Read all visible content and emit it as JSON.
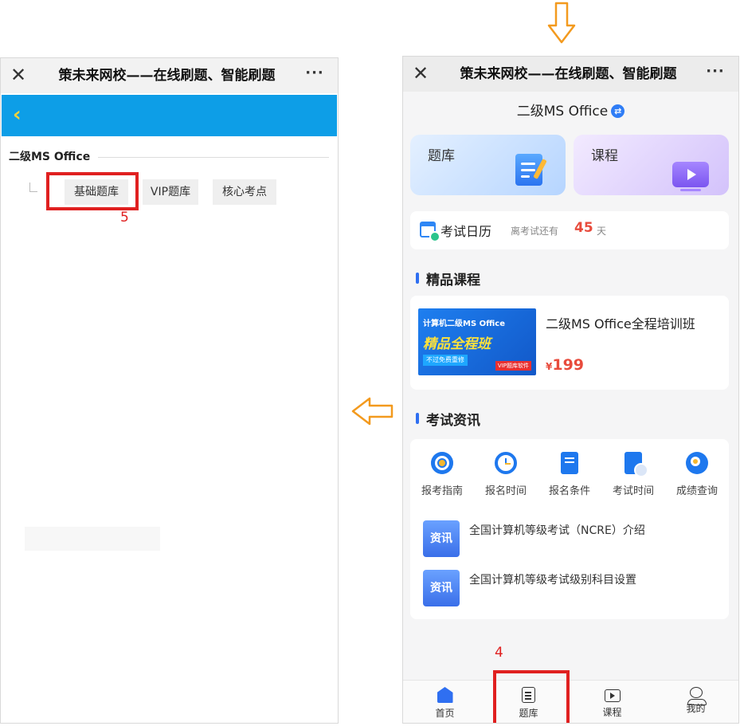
{
  "app_title": "策未来网校——在线刷题、智能刷题",
  "top_bar": {
    "close_glyph": "✕",
    "more_glyph": "···",
    "back_glyph": "‹"
  },
  "left_screen": {
    "section_title": "二级MS Office",
    "chips": [
      "基础题库",
      "VIP题库",
      "核心考点"
    ],
    "step_label": "5"
  },
  "right_screen": {
    "page_title": "二级MS Office",
    "cards": {
      "tiku_label": "题库",
      "course_label": "课程"
    },
    "exam_calendar": {
      "title": "考试日历",
      "countdown_prefix": "离考试还有",
      "countdown_days": "45",
      "countdown_unit": "天"
    },
    "featured_section_title": "精品课程",
    "course": {
      "name": "二级MS Office全程培训班",
      "price_symbol": "¥",
      "price": "199",
      "thumb_line1": "计算机二级MS Office",
      "thumb_line2": "精品全程班",
      "thumb_line3": "不过免费重修",
      "thumb_tag": "VIP题库软件"
    },
    "news_section_title": "考试资讯",
    "quick_links": [
      "报考指南",
      "报名时间",
      "报名条件",
      "考试时间",
      "成绩查询"
    ],
    "news_items": [
      {
        "tag": "资讯",
        "title": "全国计算机等级考试（NCRE）介绍"
      },
      {
        "tag": "资讯",
        "title": "全国计算机等级考试级别科目设置"
      }
    ],
    "step_label": "4",
    "tabs": [
      {
        "label": "首页",
        "icon": "home-icon"
      },
      {
        "label": "题库",
        "icon": "question-bank-icon"
      },
      {
        "label": "课程",
        "icon": "course-icon"
      },
      {
        "label": "我的",
        "icon": "profile-icon"
      }
    ]
  },
  "colors": {
    "accent_blue": "#0d9ee7",
    "annotation_red": "#e02020",
    "arrow_orange": "#f39a1e",
    "price_red": "#e84b3c"
  }
}
